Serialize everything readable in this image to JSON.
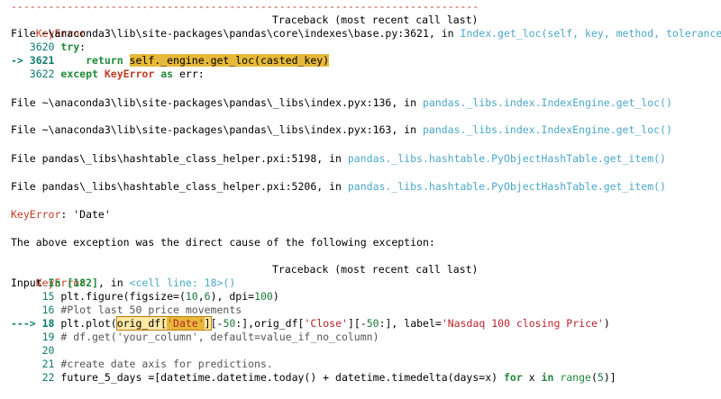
{
  "separator": "---------------------------------------------------------------------------",
  "block1": {
    "err_name": "KeyError",
    "traceback_label": "Traceback (most recent call last)",
    "file_line_prefix": "File ~\\anaconda3\\lib\\site-packages\\pandas\\core\\indexes\\base.py:3621, in ",
    "file_line_func": "Index.get_loc(self, key, method, tolerance)",
    "l3620_no": "   3620 ",
    "l3620_kw": "try",
    "l3620_tail": ":",
    "l3621_arrow": "-> 3621 ",
    "l3621_ret": "    return ",
    "l3621_hl": "self._engine.get_loc(casted_key)",
    "l3622_no": "   3622 ",
    "l3622_kw": "except",
    "l3622_err": " KeyError ",
    "l3622_as": "as",
    "l3622_tail": " err:"
  },
  "frames": [
    {
      "prefix": "File ~\\anaconda3\\lib\\site-packages\\pandas\\_libs\\index.pyx:136, in ",
      "func": "pandas._libs.index.IndexEngine.get_loc()"
    },
    {
      "prefix": "File ~\\anaconda3\\lib\\site-packages\\pandas\\_libs\\index.pyx:163, in ",
      "func": "pandas._libs.index.IndexEngine.get_loc()"
    },
    {
      "prefix": "File pandas\\_libs\\hashtable_class_helper.pxi:5198, in ",
      "func": "pandas._libs.hashtable.PyObjectHashTable.get_item()"
    },
    {
      "prefix": "File pandas\\_libs\\hashtable_class_helper.pxi:5206, in ",
      "func": "pandas._libs.hashtable.PyObjectHashTable.get_item()"
    }
  ],
  "keyerror_line": {
    "name": "KeyError",
    "msg": ": 'Date'"
  },
  "direct_cause": "The above exception was the direct cause of the following exception:",
  "block2": {
    "err_name": "KeyError",
    "traceback_label": "Traceback (most recent call last)",
    "input_prefix": "Input ",
    "input_in": "In [182]",
    "input_mid": ", in ",
    "input_cell": "<cell line: 18>",
    "input_paren": "()",
    "l15_no": "     15 ",
    "l15_code_a": "plt.figure(figsize=(",
    "l15_n1": "10",
    "l15_c": ",",
    "l15_n2": "6",
    "l15_d": "), dpi=",
    "l15_n3": "100",
    "l15_e": ")",
    "l16_no": "     16 ",
    "l16_cmt": "#Plot last 50 price movements",
    "l18_arrow": "---> 18 ",
    "l18_a": "plt.plot(",
    "l18_hl_a": "orig_df[",
    "l18_hl_str": "'Date'",
    "l18_hl_b": "]",
    "l18_b": "[-",
    "l18_n50a": "50",
    "l18_c": ":],orig_df[",
    "l18_close": "'Close'",
    "l18_d": "][-",
    "l18_n50b": "50",
    "l18_e": ":], label=",
    "l18_label": "'Nasdaq 100 closing Price'",
    "l18_f": ")",
    "l19_no": "     19 ",
    "l19_cmt": "# df.get('your_column', default=value_if_no_column)",
    "l20_no": "     20 ",
    "l21_no": "     21 ",
    "l21_cmt": "#create date axis for predictions.",
    "l22_no": "     22 ",
    "l22_a": "future_5_days =[datetime.datetime.today() + datetime.timedelta(days=x) ",
    "l22_for": "for",
    "l22_b": " x ",
    "l22_in": "in",
    "l22_c": " ",
    "l22_range": "range",
    "l22_d": "(",
    "l22_n5": "5",
    "l22_e": ")]"
  }
}
